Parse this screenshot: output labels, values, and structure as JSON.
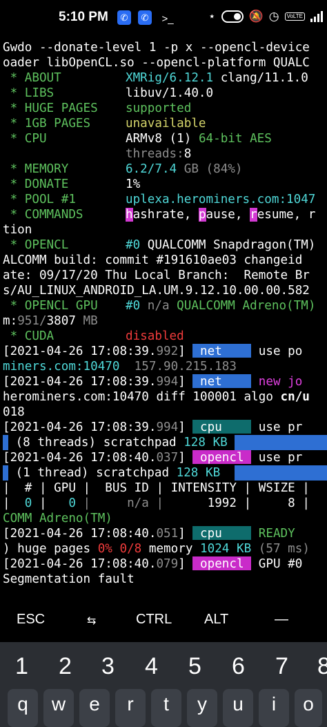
{
  "status_bar": {
    "time": "5:10 PM",
    "notifications": [
      "phone-icon",
      "phone-icon",
      "terminal-prompt-icon"
    ],
    "terminal_glyph": ">_",
    "volte": "VoLTE",
    "icons": [
      "bluetooth-icon",
      "toggle-icon",
      "mute-icon",
      "alarm-icon",
      "volte-icon",
      "signal-icon"
    ]
  },
  "terminal": {
    "l01": "Gwdo --donate-level 1 -p x --opencl-device",
    "l02": "oader libOpenCL.so --opencl-platform QUALC",
    "about_label": " * ABOUT",
    "about_name": "XMRig/6.12.1",
    "about_rest": " clang/11.1.0",
    "libs_label": " * LIBS",
    "libs_val": "libuv/1.40.0",
    "huge_label": " * HUGE PAGES",
    "huge_val": "supported",
    "gb_label": " * 1GB PAGES",
    "gb_val": "unavailable",
    "cpu_label": " * CPU",
    "cpu_val1": "ARMv8 (1) ",
    "cpu_val2": "64-bit AES",
    "threads_label": "threads:",
    "threads_val": "8",
    "mem_label": " * MEMORY",
    "mem_val": "6.2/7.4",
    "mem_unit": " GB (84%)",
    "don_label": " * DONATE",
    "don_val": "1%",
    "pool_label": " * POOL #1",
    "pool_val": "uplexa.herominers.com:1047",
    "cmd_label": " * COMMANDS",
    "cmd_h": "h",
    "cmd_h_rest": "ashrate, ",
    "cmd_p": "p",
    "cmd_p_rest": "ause, ",
    "cmd_r": "r",
    "cmd_r_rest": "esume, r",
    "cmd_cont": "tion",
    "ocl_label": " * OPENCL",
    "ocl_num": "#0",
    "ocl_val": " QUALCOMM Snapdragon(TM)",
    "l_alcomm": "ALCOMM build: commit #191610ae03 changeid",
    "l_ate": "ate: 09/17/20 Thu Local Branch:  Remote Br",
    "l_sau": "s/AU_LINUX_ANDROID_LA.UM.9.12.10.00.00.582",
    "gpu_label": " * OPENCL GPU",
    "gpu_num": "#0",
    "gpu_na": " n/a ",
    "gpu_val": "QUALCOMM Adreno(TM)",
    "gpu_m": "m:",
    "gpu_mem1": "951/",
    "gpu_mem2": "3807",
    "gpu_mb": " MB",
    "cuda_label": " * CUDA",
    "cuda_val": "disabled",
    "log1_ts": "[2021-04-26 17:08:39.",
    "log1_ms": "992",
    "log1_close": "]",
    "log1_tag": " net    ",
    "log1_msg": " use po",
    "log1b_host": "miners.com:10470",
    "log1b_ip": "  157.90.215.183",
    "log2_ts": "[2021-04-26 17:08:39.",
    "log2_ms": "994",
    "log2_close": "]",
    "log2_tag": " net    ",
    "log2_msg": " new jo",
    "log2b": "herominers.com:10470 diff 100001 algo ",
    "log2b_algo": "cn/u",
    "log2c": "018",
    "log3_ts": "[2021-04-26 17:08:39.",
    "log3_ms": "994",
    "log3_close": "]",
    "log3_tag": " cpu    ",
    "log3_msg": " use pr",
    "log3b_a": " (8 threads) scratchpad ",
    "log3b_b": "128 KB",
    "log4_ts": "[2021-04-26 17:08:40.",
    "log4_ms": "037",
    "log4_close": "]",
    "log4_tag": " opencl ",
    "log4_msg": " use pr",
    "log4b_a": " (1 thread) scratchpad ",
    "log4b_b": "128 KB",
    "tbl_head": "|  # | GPU |  BUS ID | INTENSITY | WSIZE |",
    "tbl_row_pre": "|  ",
    "tbl_row_0": "0",
    "tbl_row_mid": " |   ",
    "tbl_row_gpu": "0",
    "tbl_row_bus": " |     n/a |",
    "tbl_row_int": "      1992",
    "tbl_row_sep": " |",
    "tbl_row_ws": "     8",
    "tbl_row_end": " |",
    "tbl_comm": "COMM Adreno(TM)",
    "log5_ts": "[2021-04-26 17:08:40.",
    "log5_ms": "051",
    "log5_close": "]",
    "log5_tag": " cpu    ",
    "log5_msg": " READY",
    "log5b_a": ") huge pages ",
    "log5b_pct": "0%",
    "log5b_frac": " 0/8",
    "log5b_mem": " memory ",
    "log5b_kb": "1024 KB",
    "log5b_ms": " (57 ms)",
    "log6_ts": "[2021-04-26 17:08:40.",
    "log6_ms": "079",
    "log6_close": "]",
    "log6_tag": " opencl ",
    "log6_msg": " GPU #0",
    "segfault": "Segmentation fault"
  },
  "extra_keys": {
    "esc": "ESC",
    "tab": "⇆",
    "ctrl": "CTRL",
    "alt": "ALT",
    "dash": "—"
  },
  "keyboard": {
    "numbers": [
      "1",
      "2",
      "3",
      "4",
      "5",
      "6",
      "7",
      "8"
    ],
    "letters": [
      "q",
      "w",
      "e",
      "r",
      "t",
      "y",
      "u",
      "i",
      "o"
    ]
  }
}
